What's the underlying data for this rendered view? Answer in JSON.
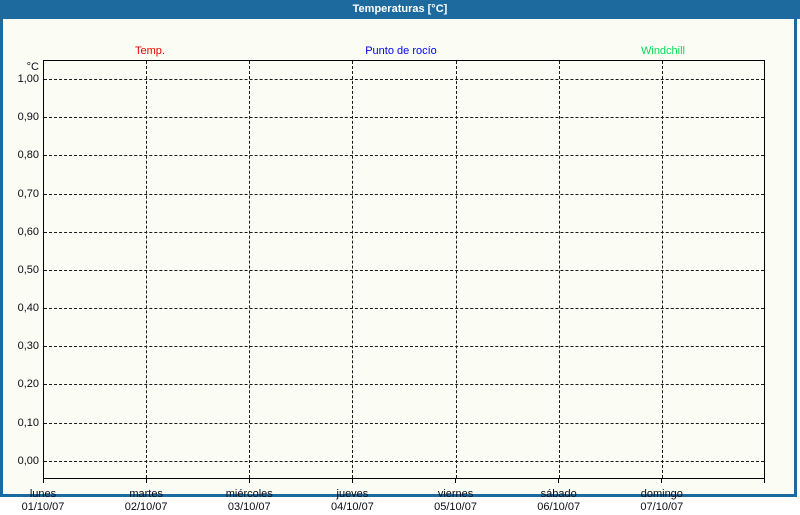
{
  "window": {
    "title": "Temperaturas [°C]"
  },
  "theme": {
    "titlebar_bg": "#1d6a9e",
    "frame_color": "#1d6a9e",
    "content_bg": "#fbfdf5",
    "axis_text_color": "#0a0a14"
  },
  "legend": [
    {
      "label": "Temp.",
      "color": "#ee0000"
    },
    {
      "label": "Punto de rocío",
      "color": "#0000ee"
    },
    {
      "label": "Windchill",
      "color": "#00dd55"
    }
  ],
  "chart_data": {
    "type": "line",
    "title": "Temperaturas [°C]",
    "ylabel": "°C",
    "xlabel": "",
    "ylim": [
      0.0,
      1.0
    ],
    "y_tick_step": 0.1,
    "y_ticks_top_to_bottom": [
      "1,00",
      "0,90",
      "0,80",
      "0,70",
      "0,60",
      "0,50",
      "0,40",
      "0,30",
      "0,20",
      "0,10",
      "0,00"
    ],
    "grid": true,
    "legend_position": "top",
    "days": [
      {
        "name": "lunes",
        "date": "01/10/07"
      },
      {
        "name": "martes",
        "date": "02/10/07"
      },
      {
        "name": "miércoles",
        "date": "03/10/07"
      },
      {
        "name": "jueves",
        "date": "04/10/07"
      },
      {
        "name": "viernes",
        "date": "05/10/07"
      },
      {
        "name": "sábado",
        "date": "06/10/07"
      },
      {
        "name": "domingo",
        "date": "07/10/07"
      }
    ],
    "series": [
      {
        "name": "Temp.",
        "color": "#ee0000",
        "values": []
      },
      {
        "name": "Punto de rocío",
        "color": "#0000ee",
        "values": []
      },
      {
        "name": "Windchill",
        "color": "#00dd55",
        "values": []
      }
    ],
    "note": "empty plot - no data points drawn"
  }
}
